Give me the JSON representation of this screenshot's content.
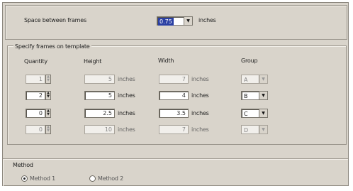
{
  "space_between_frames": {
    "label": "Space between frames",
    "value": "0.75",
    "units": "inches"
  },
  "frames_group": {
    "title": "Specify frames on template",
    "headers": {
      "quantity": "Quantity",
      "height": "Height",
      "width": "Width",
      "group": "Group"
    },
    "rows": [
      {
        "quantity": "1",
        "height": "5",
        "height_units": "inches",
        "width": "7",
        "width_units": "inches",
        "group": "A",
        "enabled": false
      },
      {
        "quantity": "2",
        "height": "5",
        "height_units": "inches",
        "width": "4",
        "width_units": "inches",
        "group": "B",
        "enabled": true
      },
      {
        "quantity": "0",
        "height": "2.5",
        "height_units": "inches",
        "width": "3.5",
        "width_units": "inches",
        "group": "C",
        "enabled": true
      },
      {
        "quantity": "0",
        "height": "10",
        "height_units": "inches",
        "width": "7",
        "width_units": "inches",
        "group": "D",
        "enabled": false
      }
    ]
  },
  "method": {
    "title": "Method",
    "options": [
      "Method 1",
      "Method 2"
    ],
    "selected": "Method 1"
  }
}
